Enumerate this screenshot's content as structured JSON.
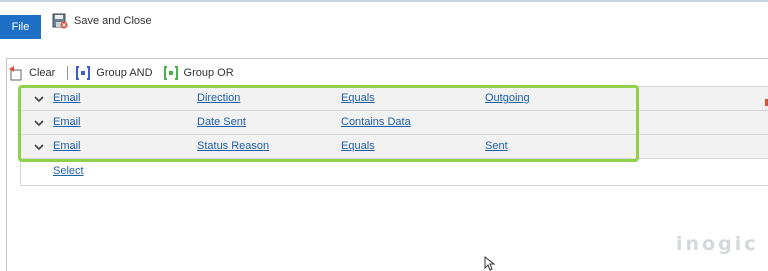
{
  "ribbon": {
    "file_label": "File",
    "save_close_label": "Save and Close"
  },
  "toolbar": {
    "clear_label": "Clear",
    "group_and_label": "Group AND",
    "group_or_label": "Group OR"
  },
  "conditions": [
    {
      "entity": "Email",
      "field": "Direction",
      "operator": "Equals",
      "value": "Outgoing"
    },
    {
      "entity": "Email",
      "field": "Date Sent",
      "operator": "Contains Data",
      "value": ""
    },
    {
      "entity": "Email",
      "field": "Status Reason",
      "operator": "Equals",
      "value": "Sent"
    }
  ],
  "select_label": "Select",
  "watermark": "inogic",
  "colors": {
    "file_button": "#1e6fc6",
    "link": "#1f5ea8",
    "highlight": "#8fd14a"
  }
}
